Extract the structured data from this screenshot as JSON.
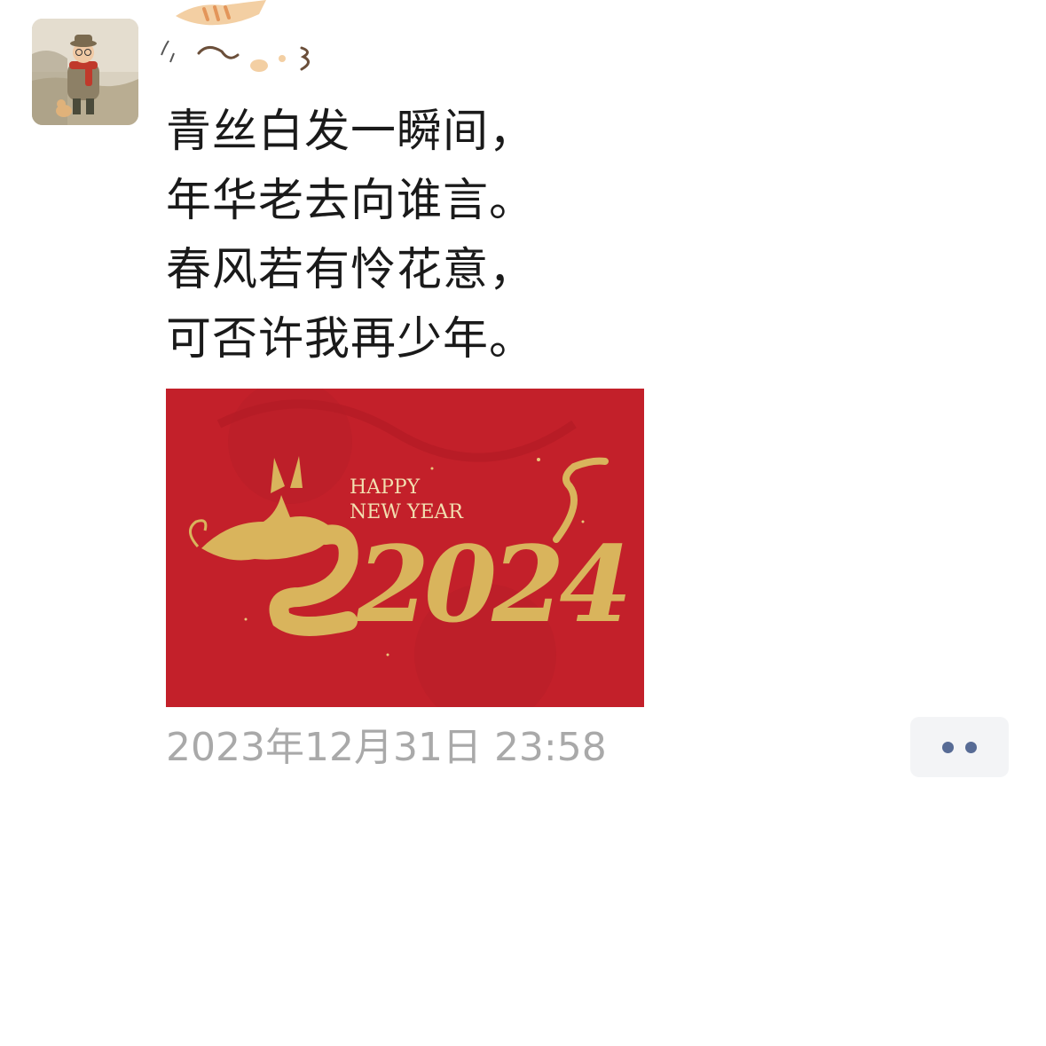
{
  "post": {
    "lines": [
      "青丝白发一瞬间，",
      "年华老去向谁言。",
      "春风若有怜花意，",
      "可否许我再少年。"
    ],
    "timestamp": "2023年12月31日 23:58"
  },
  "image": {
    "greeting_line1": "HAPPY",
    "greeting_line2": "NEW YEAR",
    "year": "2024",
    "background_color": "#c3202a",
    "gold_color": "#d9b45c"
  },
  "avatar": {
    "icon": "cartoon-old-man-avatar"
  },
  "name": {
    "icon": "cat-doodle-name-art"
  },
  "actions": {
    "more_icon": "more-dots-icon",
    "accent_color": "#576b95"
  }
}
